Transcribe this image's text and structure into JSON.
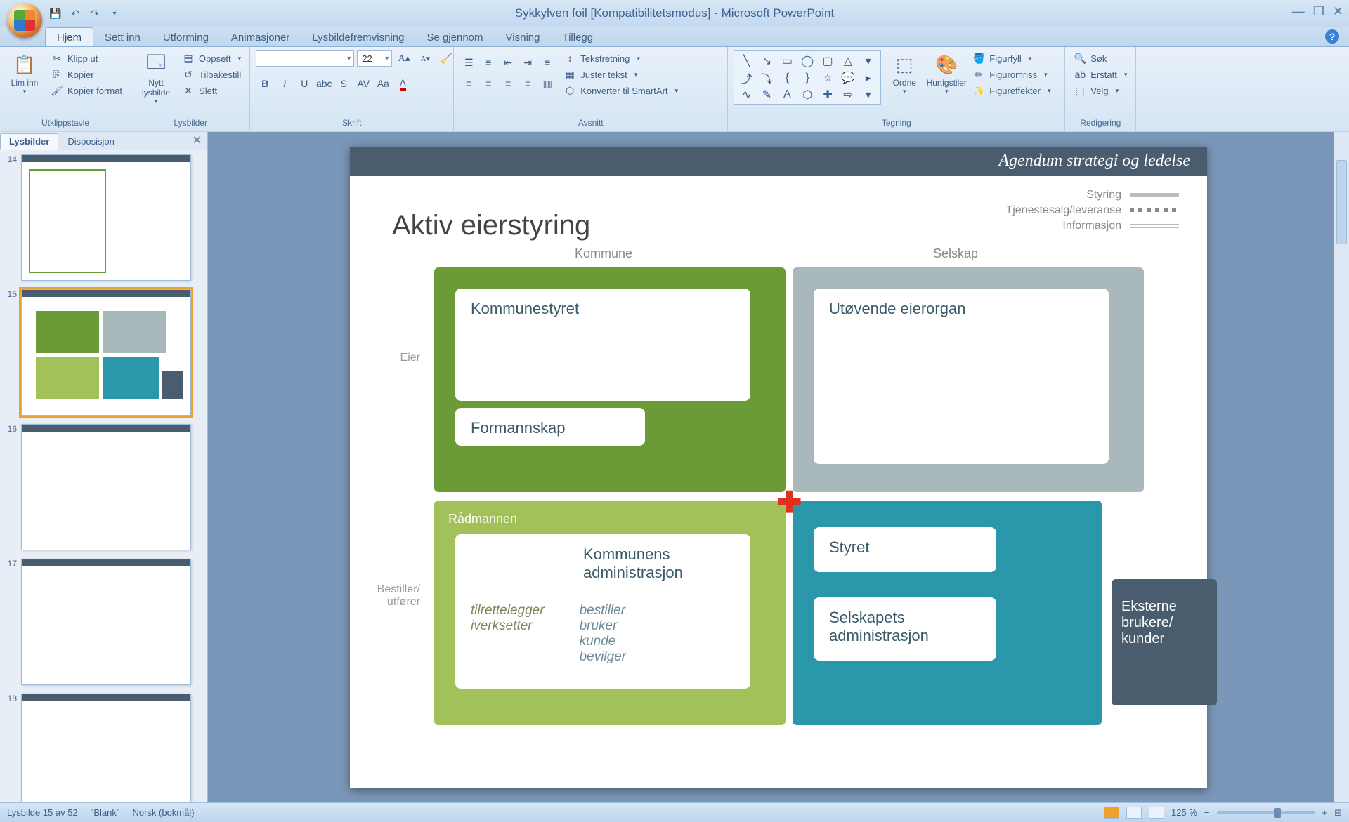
{
  "titlebar": {
    "title": "Sykkylven foil [Kompatibilitetsmodus] - Microsoft PowerPoint"
  },
  "tabs": {
    "items": [
      "Hjem",
      "Sett inn",
      "Utforming",
      "Animasjoner",
      "Lysbildefremvisning",
      "Se gjennom",
      "Visning",
      "Tillegg"
    ],
    "active": 0
  },
  "ribbon": {
    "clipboard": {
      "label": "Utklippstavle",
      "paste": "Lim inn",
      "cut": "Klipp ut",
      "copy": "Kopier",
      "format_painter": "Kopier format"
    },
    "slides": {
      "label": "Lysbilder",
      "new_slide": "Nytt lysbilde",
      "layout": "Oppsett",
      "reset": "Tilbakestill",
      "delete": "Slett"
    },
    "font": {
      "label": "Skrift",
      "size": "22"
    },
    "paragraph": {
      "label": "Avsnitt",
      "text_direction": "Tekstretning",
      "align_text": "Juster tekst",
      "convert_smartart": "Konverter til SmartArt"
    },
    "drawing": {
      "label": "Tegning",
      "arrange": "Ordne",
      "quick_styles": "Hurtigstiler",
      "shape_fill": "Figurfyll",
      "shape_outline": "Figuromriss",
      "shape_effects": "Figureffekter"
    },
    "editing": {
      "label": "Redigering",
      "find": "Søk",
      "replace": "Erstatt",
      "select": "Velg"
    }
  },
  "panel": {
    "tab_slides": "Lysbilder",
    "tab_outline": "Disposisjon",
    "thumbs": [
      {
        "num": "14"
      },
      {
        "num": "15"
      },
      {
        "num": "16"
      },
      {
        "num": "17"
      },
      {
        "num": "18"
      }
    ]
  },
  "slide": {
    "banner": "Agendum strategi og ledelse",
    "title": "Aktiv eierstyring",
    "legend": {
      "styring": "Styring",
      "tjeneste": "Tjenestesalg/leveranse",
      "info": "Informasjon"
    },
    "labels": {
      "kommune": "Kommune",
      "selskap": "Selskap",
      "eier": "Eier",
      "bestiller": "Bestiller/\nutfører",
      "radmannen": "Rådmannen"
    },
    "boxes": {
      "kommunestyret": "Kommunestyret",
      "formannskap": "Formannskap",
      "utovende": "Utøvende eierorgan",
      "kommunens_admin": "Kommunens administrasjon",
      "tilrette": "tilrettelegger\niverksetter",
      "bestiller_roles": "bestiller\nbruker\nkunde\nbevilger",
      "styret": "Styret",
      "selskapets_admin": "Selskapets administrasjon",
      "eksterne": "Eksterne brukere/ kunder"
    }
  },
  "statusbar": {
    "slide_info": "Lysbilde 15 av 52",
    "theme": "\"Blank\"",
    "language": "Norsk (bokmål)",
    "zoom": "125 %"
  }
}
